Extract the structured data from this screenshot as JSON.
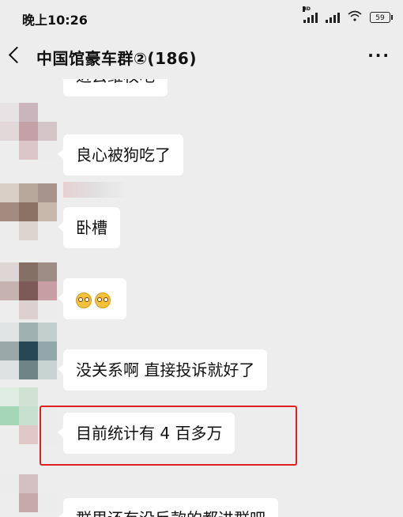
{
  "status": {
    "time": "晚上10:26",
    "hd": "HD",
    "battery": "59"
  },
  "header": {
    "title": "中国馆豪车群②(186)",
    "more": "···"
  },
  "messages": [
    {
      "text": "进去维权吧"
    },
    {
      "text": "良心被狗吃了"
    },
    {
      "text": "卧槽"
    },
    {
      "text": ""
    },
    {
      "text": "没关系啊 直接投诉就好了"
    },
    {
      "text": "目前统计有 4 百多万"
    },
    {
      "text": "群里还有没反款的都进群吧"
    }
  ],
  "emoji_names": [
    "dizzy-face-emoji",
    "dizzy-face-emoji"
  ],
  "colors": {
    "background": "#ededed",
    "bubble": "#ffffff",
    "highlight": "#e02020"
  }
}
